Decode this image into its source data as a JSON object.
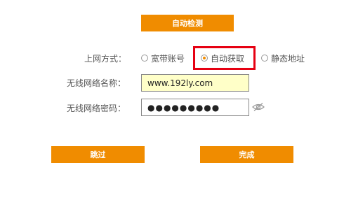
{
  "header": {
    "auto_detect_label": "自动检测"
  },
  "form": {
    "connection_mode": {
      "label": "上网方式：",
      "options": [
        {
          "label": "宽带账号",
          "selected": false
        },
        {
          "label": "自动获取",
          "selected": true
        },
        {
          "label": "静态地址",
          "selected": false
        }
      ],
      "highlight_color": "#e60012"
    },
    "ssid": {
      "label": "无线网络名称：",
      "value": "www.192ly.com"
    },
    "password": {
      "label": "无线网络密码：",
      "value": "●●●●●●●●●",
      "toggle_icon": "eye-off-icon"
    }
  },
  "footer": {
    "skip_label": "跳过",
    "done_label": "完成"
  },
  "colors": {
    "accent": "#f08c00",
    "highlight": "#e60012",
    "ssid_field_bg": "#ffffc8"
  }
}
